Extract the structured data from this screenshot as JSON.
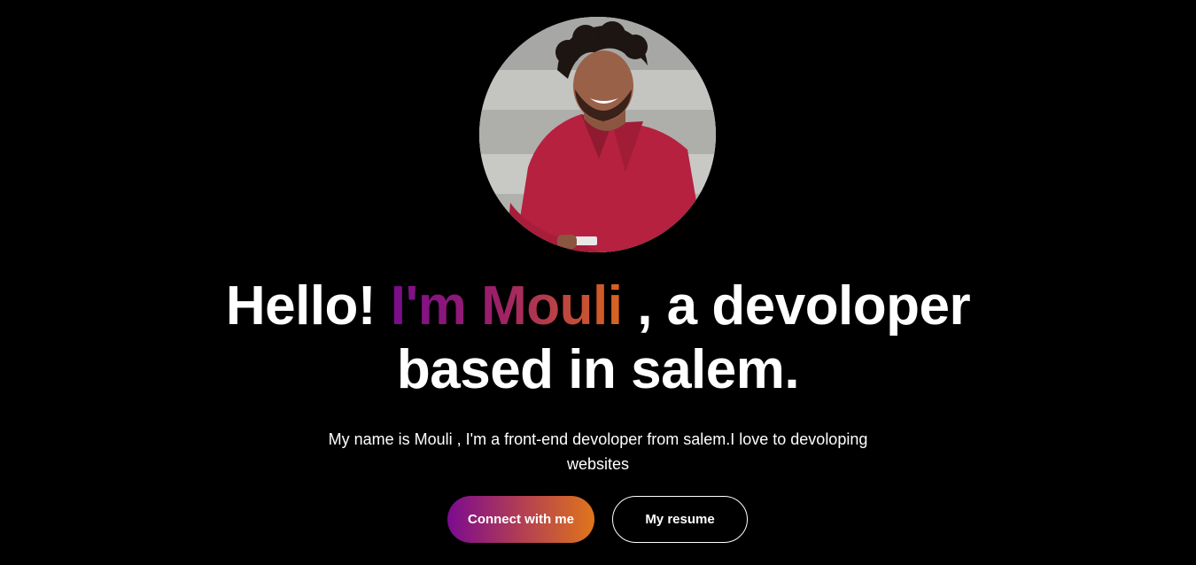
{
  "hero": {
    "avatar_icon": "profile-photo",
    "greeting": "Hello! ",
    "name": "I'm Mouli",
    "tagline_line1": " , a devoloper",
    "tagline_line2": "based in salem.",
    "intro": "My name is Mouli , I'm a front-end devoloper from salem.I love to devoloping websites"
  },
  "buttons": {
    "connect_label": "Connect with me",
    "resume_label": "My resume"
  },
  "colors": {
    "background": "#000000",
    "gradient_start": "#7b0b8f",
    "gradient_end": "#e0751a",
    "text": "#ffffff"
  }
}
